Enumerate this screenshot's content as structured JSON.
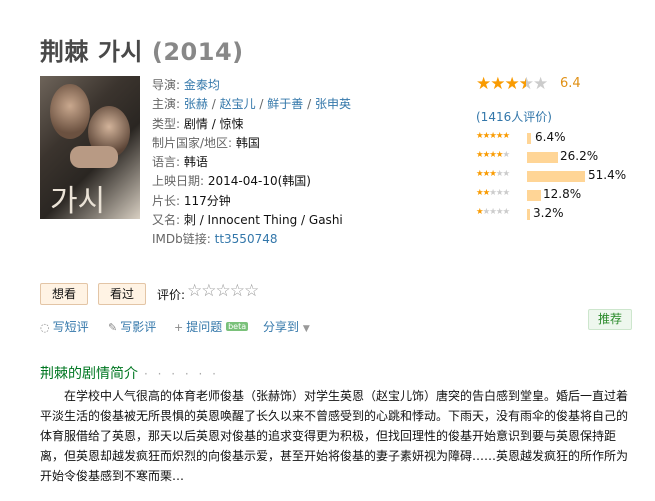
{
  "header": {
    "title": "荆棘 가시",
    "year": "(2014)"
  },
  "info": {
    "director_label": "导演:",
    "director": "金泰均",
    "cast_label": "主演:",
    "cast": [
      "张赫",
      "赵宝儿",
      "鲜于善",
      "张申英"
    ],
    "genre_label": "类型:",
    "genre": "剧情 / 惊悚",
    "country_label": "制片国家/地区:",
    "country": "韩国",
    "language_label": "语言:",
    "language": "韩语",
    "release_label": "上映日期:",
    "release": "2014-04-10(韩国)",
    "runtime_label": "片长:",
    "runtime": "117分钟",
    "aka_label": "又名:",
    "aka": "刺 / Innocent Thing / Gashi",
    "imdb_label": "IMDb链接:",
    "imdb": "tt3550748"
  },
  "rating": {
    "score": "6.4",
    "stars_filled": 3.5,
    "votes": "(1416人评价)",
    "distribution": [
      {
        "stars": 5,
        "pct": "6.4%",
        "value": 6.4
      },
      {
        "stars": 4,
        "pct": "26.2%",
        "value": 26.2
      },
      {
        "stars": 3,
        "pct": "51.4%",
        "value": 51.4
      },
      {
        "stars": 2,
        "pct": "12.8%",
        "value": 12.8
      },
      {
        "stars": 1,
        "pct": "3.2%",
        "value": 3.2
      }
    ]
  },
  "actions": {
    "want": "想看",
    "seen": "看过",
    "rate_label": "评价:",
    "short_review": "写短评",
    "long_review": "写影评",
    "ask": "提问题",
    "beta": "beta",
    "share": "分享到",
    "recommend": "推荐"
  },
  "summary": {
    "heading": "荆棘的剧情简介",
    "dots": "· · · · · ·",
    "text": "在学校中人气很高的体育老师俊基（张赫饰）对学生英恩（赵宝儿饰）唐突的告白感到堂皇。婚后一直过着平淡生活的俊基被无所畏惧的英恩唤醒了长久以来不曾感受到的心跳和悸动。下雨天，没有雨伞的俊基将自己的体育服借给了英恩，那天以后英恩对俊基的追求变得更为积极，但找回理性的俊基开始意识到要与英恩保持距离，但英恩却越发疯狂而炽烈的向俊基示爱，甚至开始将俊基的妻子素妍视为障碍……英恩越发疯狂的所作所为开始令俊基感到不寒而栗…"
  }
}
